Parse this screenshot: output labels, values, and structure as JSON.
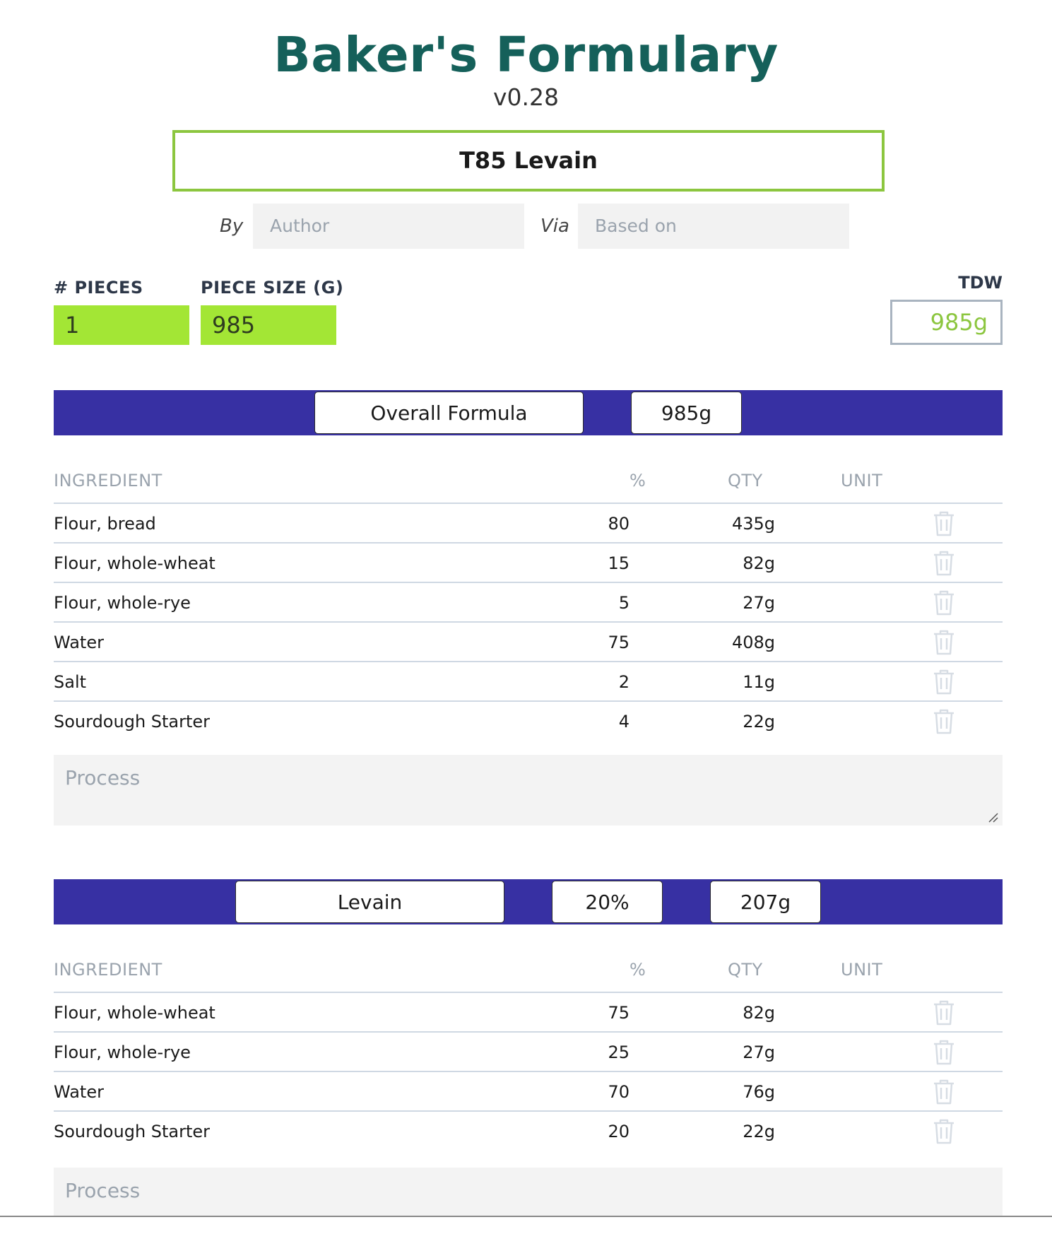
{
  "app": {
    "title": "Baker's Formulary",
    "version": "v0.28"
  },
  "recipe": {
    "name": "T85 Levain",
    "by_label": "By",
    "author_placeholder": "Author",
    "via_label": "Via",
    "based_on_placeholder": "Based on"
  },
  "settings": {
    "pieces_label": "# PIECES",
    "pieces_value": "1",
    "piece_size_label": "PIECE SIZE (G)",
    "piece_size_value": "985",
    "tdw_label": "TDW",
    "tdw_value": "985g"
  },
  "columns": {
    "ingredient": "INGREDIENT",
    "percent": "%",
    "qty": "QTY",
    "unit": "UNIT"
  },
  "overall": {
    "name": "Overall Formula",
    "total": "985g",
    "rows": [
      {
        "ingredient": "Flour, bread",
        "percent": "80",
        "qty": "435g"
      },
      {
        "ingredient": "Flour, whole-wheat",
        "percent": "15",
        "qty": "82g"
      },
      {
        "ingredient": "Flour, whole-rye",
        "percent": "5",
        "qty": "27g"
      },
      {
        "ingredient": "Water",
        "percent": "75",
        "qty": "408g"
      },
      {
        "ingredient": "Salt",
        "percent": "2",
        "qty": "11g"
      },
      {
        "ingredient": "Sourdough Starter",
        "percent": "4",
        "qty": "22g"
      }
    ],
    "process_placeholder": "Process"
  },
  "levain": {
    "name": "Levain",
    "percent": "20%",
    "total": "207g",
    "rows": [
      {
        "ingredient": "Flour, whole-wheat",
        "percent": "75",
        "qty": "82g"
      },
      {
        "ingredient": "Flour, whole-rye",
        "percent": "25",
        "qty": "27g"
      },
      {
        "ingredient": "Water",
        "percent": "70",
        "qty": "76g"
      },
      {
        "ingredient": "Sourdough Starter",
        "percent": "20",
        "qty": "22g"
      }
    ],
    "process_placeholder": "Process"
  },
  "colors": {
    "title": "#15605a",
    "accent_green": "#8cc63f",
    "input_green": "#a3e635",
    "section_bar": "#3730a3",
    "trash_icon": "#d7dde4"
  },
  "icons": {
    "delete": "trash-icon"
  }
}
